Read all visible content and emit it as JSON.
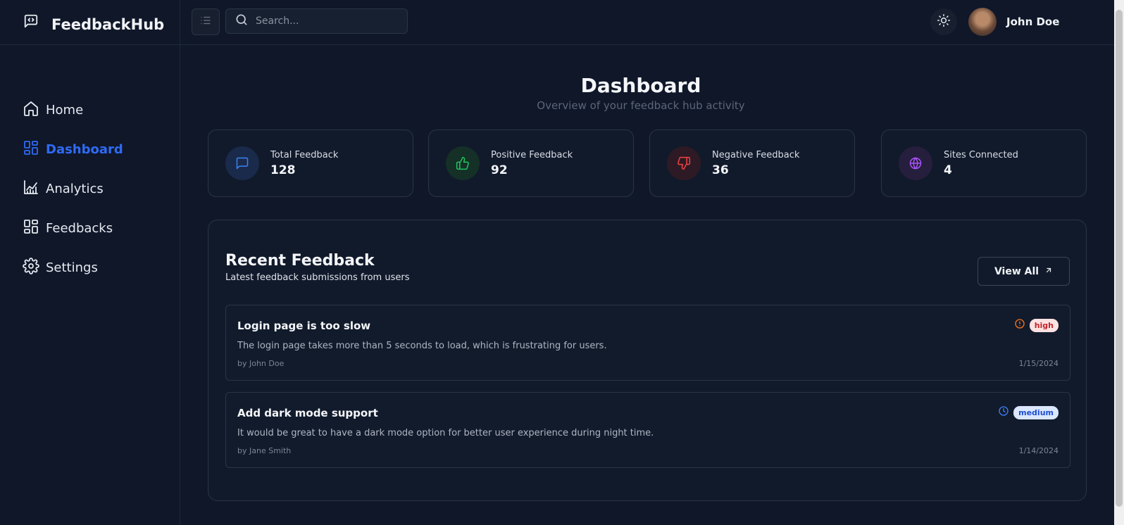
{
  "brand": {
    "name": "FeedbackHub"
  },
  "nav": [
    {
      "label": "Home",
      "icon": "home-icon",
      "active": false
    },
    {
      "label": "Dashboard",
      "icon": "dashboard-icon",
      "active": true
    },
    {
      "label": "Analytics",
      "icon": "analytics-icon",
      "active": false
    },
    {
      "label": "Feedbacks",
      "icon": "feedbacks-icon",
      "active": false
    },
    {
      "label": "Settings",
      "icon": "settings-icon",
      "active": false
    }
  ],
  "header": {
    "search_placeholder": "Search...",
    "user_name": "John Doe"
  },
  "page": {
    "title": "Dashboard",
    "subtitle": "Overview of your feedback hub activity"
  },
  "stats": [
    {
      "label": "Total Feedback",
      "value": "128",
      "icon": "message-icon",
      "color": "#3b82f6"
    },
    {
      "label": "Positive Feedback",
      "value": "92",
      "icon": "thumbs-up-icon",
      "color": "#22c55e"
    },
    {
      "label": "Negative Feedback",
      "value": "36",
      "icon": "thumbs-down-icon",
      "color": "#ef4444"
    },
    {
      "label": "Sites Connected",
      "value": "4",
      "icon": "globe-icon",
      "color": "#a855f7"
    }
  ],
  "recent": {
    "title": "Recent Feedback",
    "subtitle": "Latest feedback submissions from users",
    "view_all_label": "View All",
    "items": [
      {
        "title": "Login page is too slow",
        "description": "The login page takes more than 5 seconds to load, which is frustrating for users.",
        "author": "by John Doe",
        "date": "1/15/2024",
        "priority": "high",
        "status_icon": "alert-circle-icon"
      },
      {
        "title": "Add dark mode support",
        "description": "It would be great to have a dark mode option for better user experience during night time.",
        "author": "by Jane Smith",
        "date": "1/14/2024",
        "priority": "medium",
        "status_icon": "clock-icon"
      }
    ]
  },
  "colors": {
    "accent": "#2f6bf5",
    "background": "#0f1729",
    "card": "#111a2b",
    "border": "#2a3547"
  }
}
